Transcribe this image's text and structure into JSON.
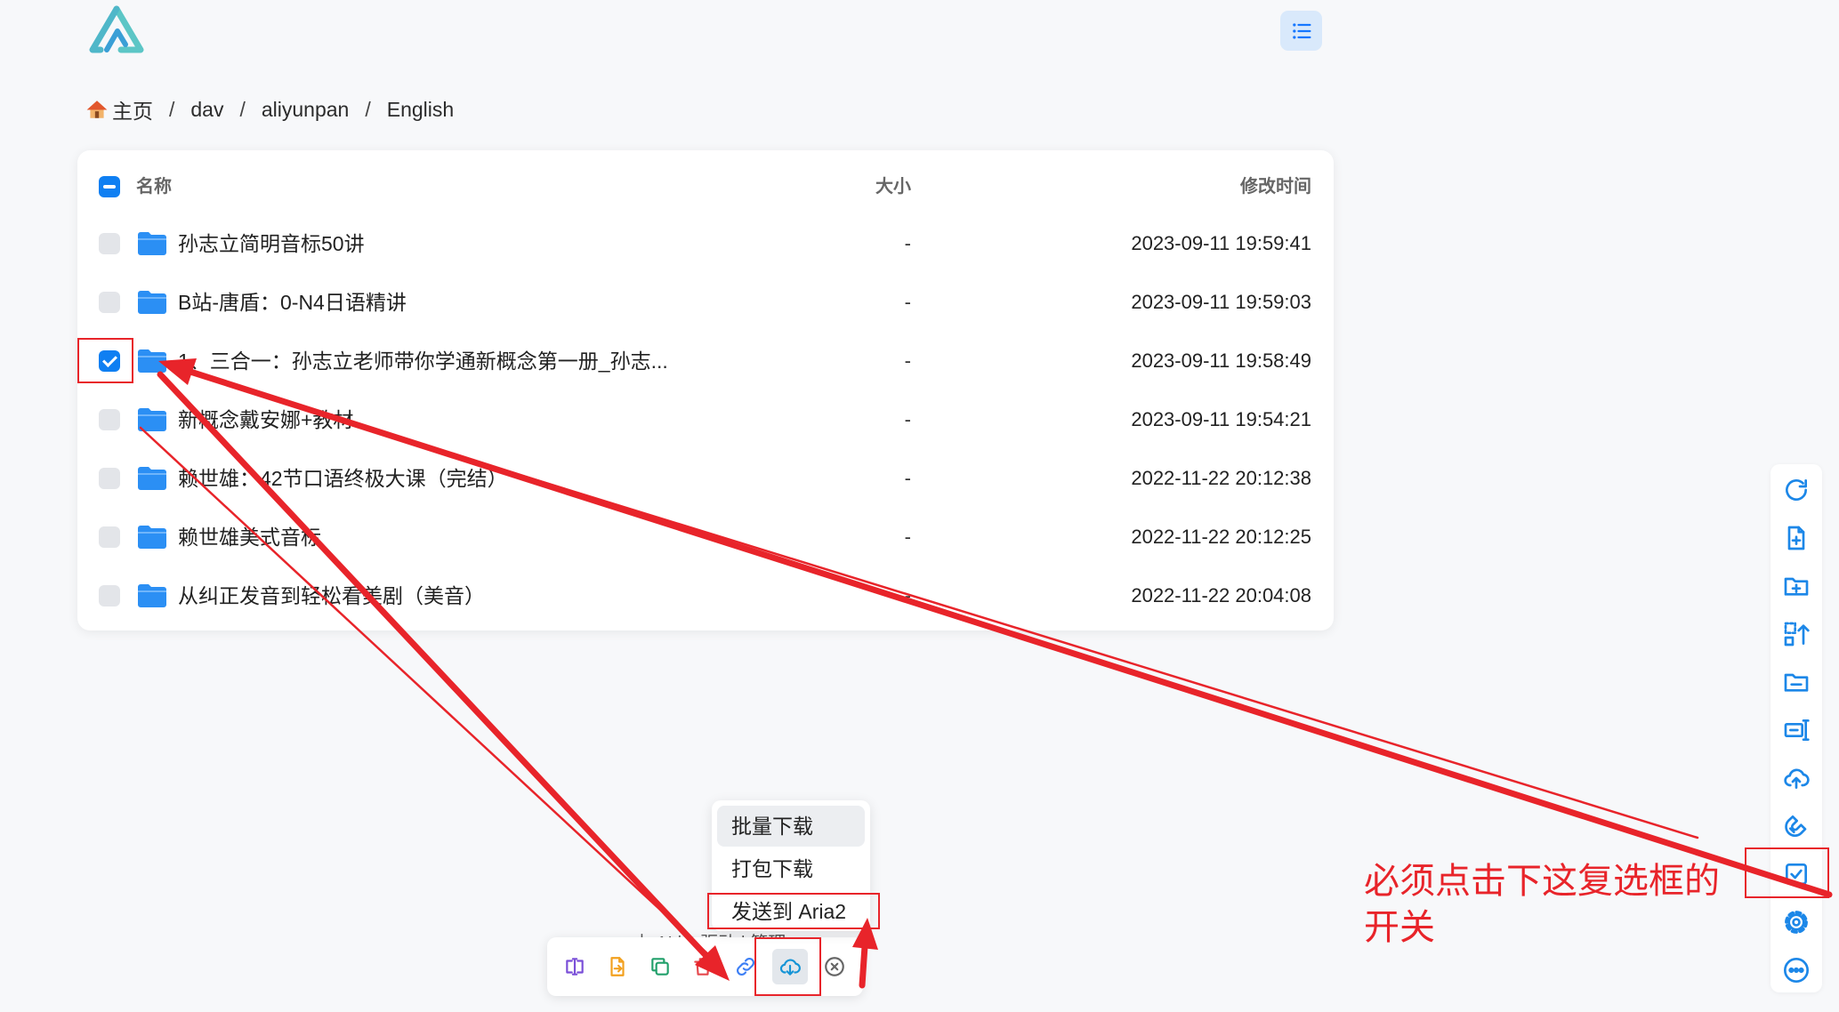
{
  "header": {
    "logo_icon": "alist-logo-icon",
    "view_toggle_icon": "list-view-icon"
  },
  "breadcrumb": {
    "home_icon": "house-icon",
    "separator": "/",
    "items": [
      {
        "label": "主页"
      },
      {
        "label": "dav"
      },
      {
        "label": "aliyunpan"
      },
      {
        "label": "English"
      }
    ]
  },
  "file_list": {
    "select_all_state": "indeterminate",
    "columns": {
      "name": "名称",
      "size": "大小",
      "modified": "修改时间"
    },
    "rows": [
      {
        "name": "孙志立简明音标50讲",
        "size": "-",
        "modified": "2023-09-11 19:59:41",
        "state": "unchecked",
        "icon": "folder-icon"
      },
      {
        "name": "B站-唐盾：0-N4日语精讲",
        "size": "-",
        "modified": "2023-09-11 19:59:03",
        "state": "unchecked",
        "icon": "folder-icon"
      },
      {
        "name": "1、三合一：孙志立老师带你学通新概念第一册_孙志...",
        "size": "-",
        "modified": "2023-09-11 19:58:49",
        "state": "checked",
        "icon": "folder-icon"
      },
      {
        "name": "新概念戴安娜+教材",
        "size": "-",
        "modified": "2023-09-11 19:54:21",
        "state": "unchecked",
        "icon": "folder-icon"
      },
      {
        "name": "赖世雄：42节口语终极大课（完结）",
        "size": "-",
        "modified": "2022-11-22 20:12:38",
        "state": "unchecked",
        "icon": "folder-icon"
      },
      {
        "name": "赖世雄美式音标",
        "size": "-",
        "modified": "2022-11-22 20:12:25",
        "state": "unchecked",
        "icon": "folder-icon"
      },
      {
        "name": "从纠正发音到轻松看美剧（美音）",
        "size": "-",
        "modified": "2022-11-22 20:04:08",
        "state": "unchecked",
        "icon": "folder-icon"
      }
    ]
  },
  "right_toolbar": {
    "items": [
      {
        "icon": "refresh-icon"
      },
      {
        "icon": "new-file-icon"
      },
      {
        "icon": "new-folder-icon"
      },
      {
        "icon": "recursive-move-icon"
      },
      {
        "icon": "remove-empty-folder-icon"
      },
      {
        "icon": "batch-rename-icon"
      },
      {
        "icon": "upload-icon"
      },
      {
        "icon": "offline-download-icon"
      },
      {
        "icon": "toggle-checkbox-icon"
      },
      {
        "icon": "settings-icon"
      },
      {
        "icon": "more-icon"
      }
    ]
  },
  "batch_menu": {
    "items": [
      {
        "label": "批量下载",
        "highlighted": true
      },
      {
        "label": "打包下载"
      },
      {
        "label": "发送到 Aria2"
      }
    ]
  },
  "footer": {
    "text": "由 AList 驱动 | 管理"
  },
  "bottom_toolbar": {
    "items": [
      {
        "icon": "rename-icon"
      },
      {
        "icon": "move-icon"
      },
      {
        "icon": "copy-icon"
      },
      {
        "icon": "delete-icon"
      },
      {
        "icon": "copy-link-icon"
      },
      {
        "icon": "download-icon",
        "active": true
      },
      {
        "icon": "cancel-icon"
      }
    ]
  },
  "annotation": {
    "lines": [
      "必须点击下这复选框的",
      "开关"
    ]
  },
  "colors": {
    "accent": "#0f7ff2",
    "folder": "#2b8ff4",
    "annotation": "#e8242a",
    "background": "#f7f8fa"
  }
}
